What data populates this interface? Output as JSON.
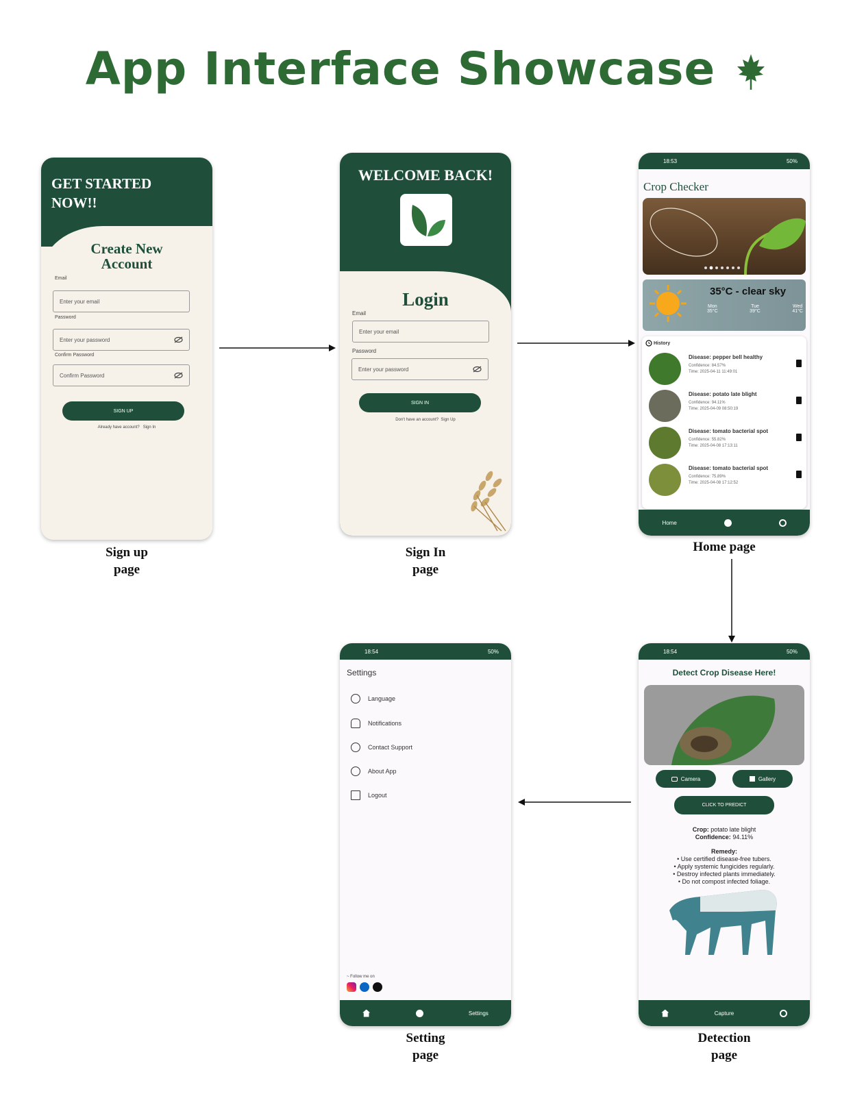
{
  "title": "App Interface Showcase",
  "signup": {
    "heading_line1": "GET STARTED",
    "heading_line2": "NOW!!",
    "form_title_line1": "Create New",
    "form_title_line2": "Account",
    "email_label": "Email",
    "email_placeholder": "Enter your email",
    "password_label": "Password",
    "password_placeholder": "Enter your password",
    "confirm_label": "Confirm Password",
    "confirm_placeholder": "Confirm Password",
    "button": "SIGN UP",
    "footer_text": "Already have account?",
    "footer_link": "Sign In",
    "caption_line1": "Sign up",
    "caption_line2": "page"
  },
  "signin": {
    "heading": "WELCOME BACK!",
    "form_title": "Login",
    "email_label": "Email",
    "email_placeholder": "Enter your email",
    "password_label": "Password",
    "password_placeholder": "Enter your password",
    "button": "SIGN IN",
    "footer_text": "Don't have an account?",
    "footer_link": "Sign Up",
    "caption_line1": "Sign In",
    "caption_line2": "page"
  },
  "home": {
    "status_time": "18:53",
    "status_right": "50%",
    "app_title": "Crop Checker",
    "weather_summary": "35°C - clear sky",
    "forecast": [
      {
        "day": "Mon",
        "temp": "35°C"
      },
      {
        "day": "Tue",
        "temp": "39°C"
      },
      {
        "day": "Wed",
        "temp": "41°C"
      }
    ],
    "history_label": "History",
    "history": [
      {
        "disease": "Disease: pepper bell healthy",
        "confidence": "Confidence: 84.57%",
        "time": "Time: 2025-04-11 11:49:01",
        "color": "#3f7a2c"
      },
      {
        "disease": "Disease: potato late blight",
        "confidence": "Confidence: 94.11%",
        "time": "Time: 2025-04-09 08:50:19",
        "color": "#6c6c5c"
      },
      {
        "disease": "Disease: tomato bacterial spot",
        "confidence": "Confidence: 55.82%",
        "time": "Time: 2025-04-08 17:13:11",
        "color": "#5d7a2e"
      },
      {
        "disease": "Disease: tomato bacterial spot",
        "confidence": "Confidence: 75.89%",
        "time": "Time: 2025-04-08 17:12:52",
        "color": "#7d8f3a"
      }
    ],
    "nav_home": "Home",
    "caption": "Home page"
  },
  "settings": {
    "status_time": "18:54",
    "status_right": "50%",
    "title": "Settings",
    "items": [
      "Language",
      "Notifications",
      "Contact Support",
      "About App",
      "Logout"
    ],
    "follow_label": "~ Follow me on",
    "nav_settings": "Settings",
    "caption_line1": "Setting",
    "caption_line2": "page"
  },
  "detect": {
    "status_time": "18:54",
    "status_right": "50%",
    "title": "Detect Crop Disease Here!",
    "camera": "Camera",
    "gallery": "Gallery",
    "predict": "CLICK TO PREDICT",
    "crop_label": "Crop:",
    "crop_value": "potato late blight",
    "confidence_label": "Confidence:",
    "confidence_value": "94.11%",
    "remedy_label": "Remedy:",
    "remedies": [
      "• Use certified disease-free tubers.",
      "• Apply systemic fungicides regularly.",
      "• Destroy infected plants immediately.",
      "• Do not compost infected foliage."
    ],
    "nav_capture": "Capture",
    "caption_line1": "Detection",
    "caption_line2": "page"
  }
}
